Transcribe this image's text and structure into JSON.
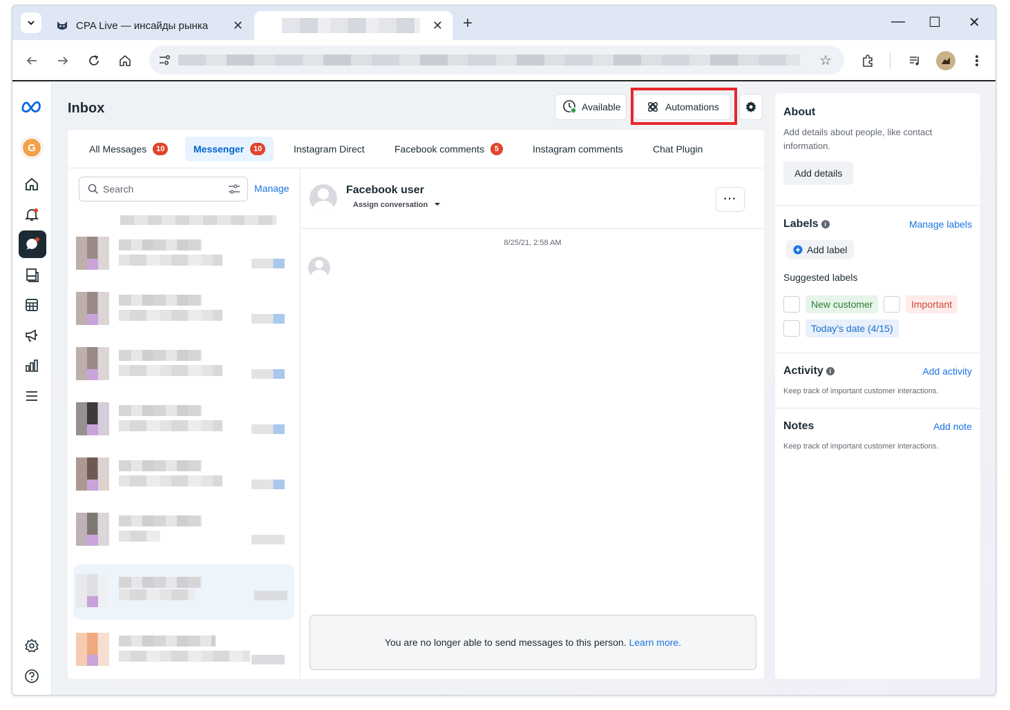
{
  "browser": {
    "tabs": [
      {
        "title": "CPA Live — инсайды рынка",
        "close": "✕"
      },
      {
        "title": "",
        "close": "✕"
      }
    ],
    "new_tab": "+",
    "window_controls": {
      "minimize": "—",
      "maximize": "☐",
      "close": "✕"
    }
  },
  "header": {
    "title": "Inbox",
    "available_label": "Available",
    "automations_label": "Automations"
  },
  "message_tabs": [
    {
      "label": "All Messages",
      "badge": "10"
    },
    {
      "label": "Messenger",
      "badge": "10"
    },
    {
      "label": "Instagram Direct"
    },
    {
      "label": "Facebook comments",
      "badge": "5"
    },
    {
      "label": "Instagram comments"
    },
    {
      "label": "Chat Plugin"
    }
  ],
  "list": {
    "search_placeholder": "Search",
    "manage_label": "Manage"
  },
  "chat": {
    "name": "Facebook user",
    "assign_label": "Assign conversation",
    "more_label": "···",
    "timestamp": "8/25/21, 2:58 AM",
    "notice_text": "You are no longer able to send messages to this person.",
    "notice_link": "Learn more."
  },
  "about": {
    "title": "About",
    "description": "Add details about people, like contact information.",
    "button": "Add details"
  },
  "labels": {
    "title": "Labels",
    "manage_link": "Manage labels",
    "add_label": "Add label",
    "suggested_title": "Suggested labels",
    "suggested": [
      "New customer",
      "Important",
      "Today's date (4/15)"
    ]
  },
  "activity": {
    "title": "Activity",
    "link": "Add activity",
    "description": "Keep track of important customer interactions."
  },
  "notes": {
    "title": "Notes",
    "link": "Add note",
    "description": "Keep track of important customer interactions."
  },
  "colors": {
    "accent": "#1b74e4",
    "badge": "#e0442d",
    "highlight": "#e8262a",
    "active_nav": "#1c2b33"
  }
}
